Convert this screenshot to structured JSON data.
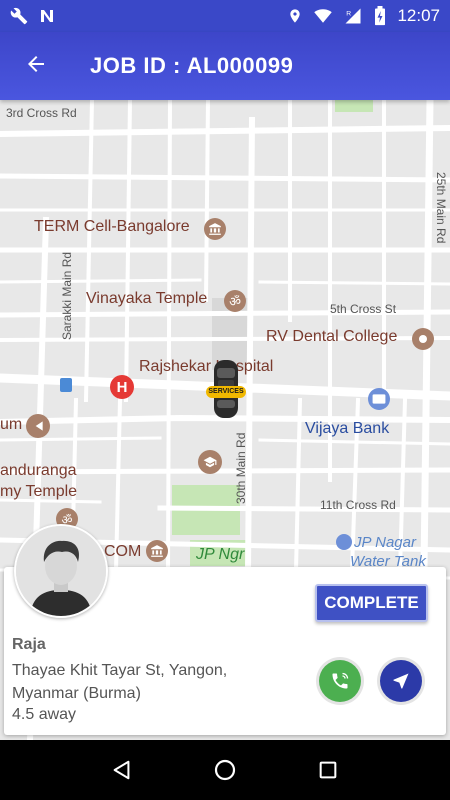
{
  "status_bar": {
    "time": "12:07",
    "left_icons": [
      "wrench-icon",
      "notification-n-icon"
    ],
    "right_icons": [
      "location-pin-icon",
      "wifi-icon",
      "signal-roaming-icon",
      "battery-charging-icon"
    ]
  },
  "app_bar": {
    "back_icon": "arrow-back-icon",
    "title": "JOB ID : AL000099",
    "color": "#3d46c9"
  },
  "map": {
    "labels": {
      "third_cross": "3rd Cross Rd",
      "twentyfifth_main": "25th Main Rd",
      "term_cell": "TERM Cell-Bangalore",
      "sarakki": "Sarakki Main Rd",
      "vinayaka": "Vinayaka Temple",
      "fifth_cross": "5th Cross St",
      "rv_dental": "RV Dental College",
      "rajshekar": "Rajshekar Hospital",
      "um": "um",
      "vijaya_bank": "Vijaya Bank",
      "thirtieth_main": "30th Main Rd",
      "panduranga_1": "anduranga",
      "panduranga_2": "my Temple",
      "eleventh_cross": "11th Cross Rd",
      "jp_nagar_1": "JP Nagar",
      "jp_nagar_2": "Water Tank",
      "com": "COM",
      "jp_ngr": "JP Ngr"
    },
    "vehicle_badge": "SERVICES"
  },
  "job_card": {
    "complete_label": "COMPLETE",
    "customer_name": "Raja",
    "address": "Thayae Khit Tayar St, Yangon, Myanmar (Burma)",
    "distance": "4.5 away",
    "call_icon": "phone-icon",
    "navigate_icon": "navigation-arrow-icon",
    "accent": "#3f51c4",
    "call_color": "#4caf50"
  },
  "system_nav": {
    "icons": [
      "back-triangle-icon",
      "home-circle-icon",
      "recents-square-icon"
    ]
  }
}
